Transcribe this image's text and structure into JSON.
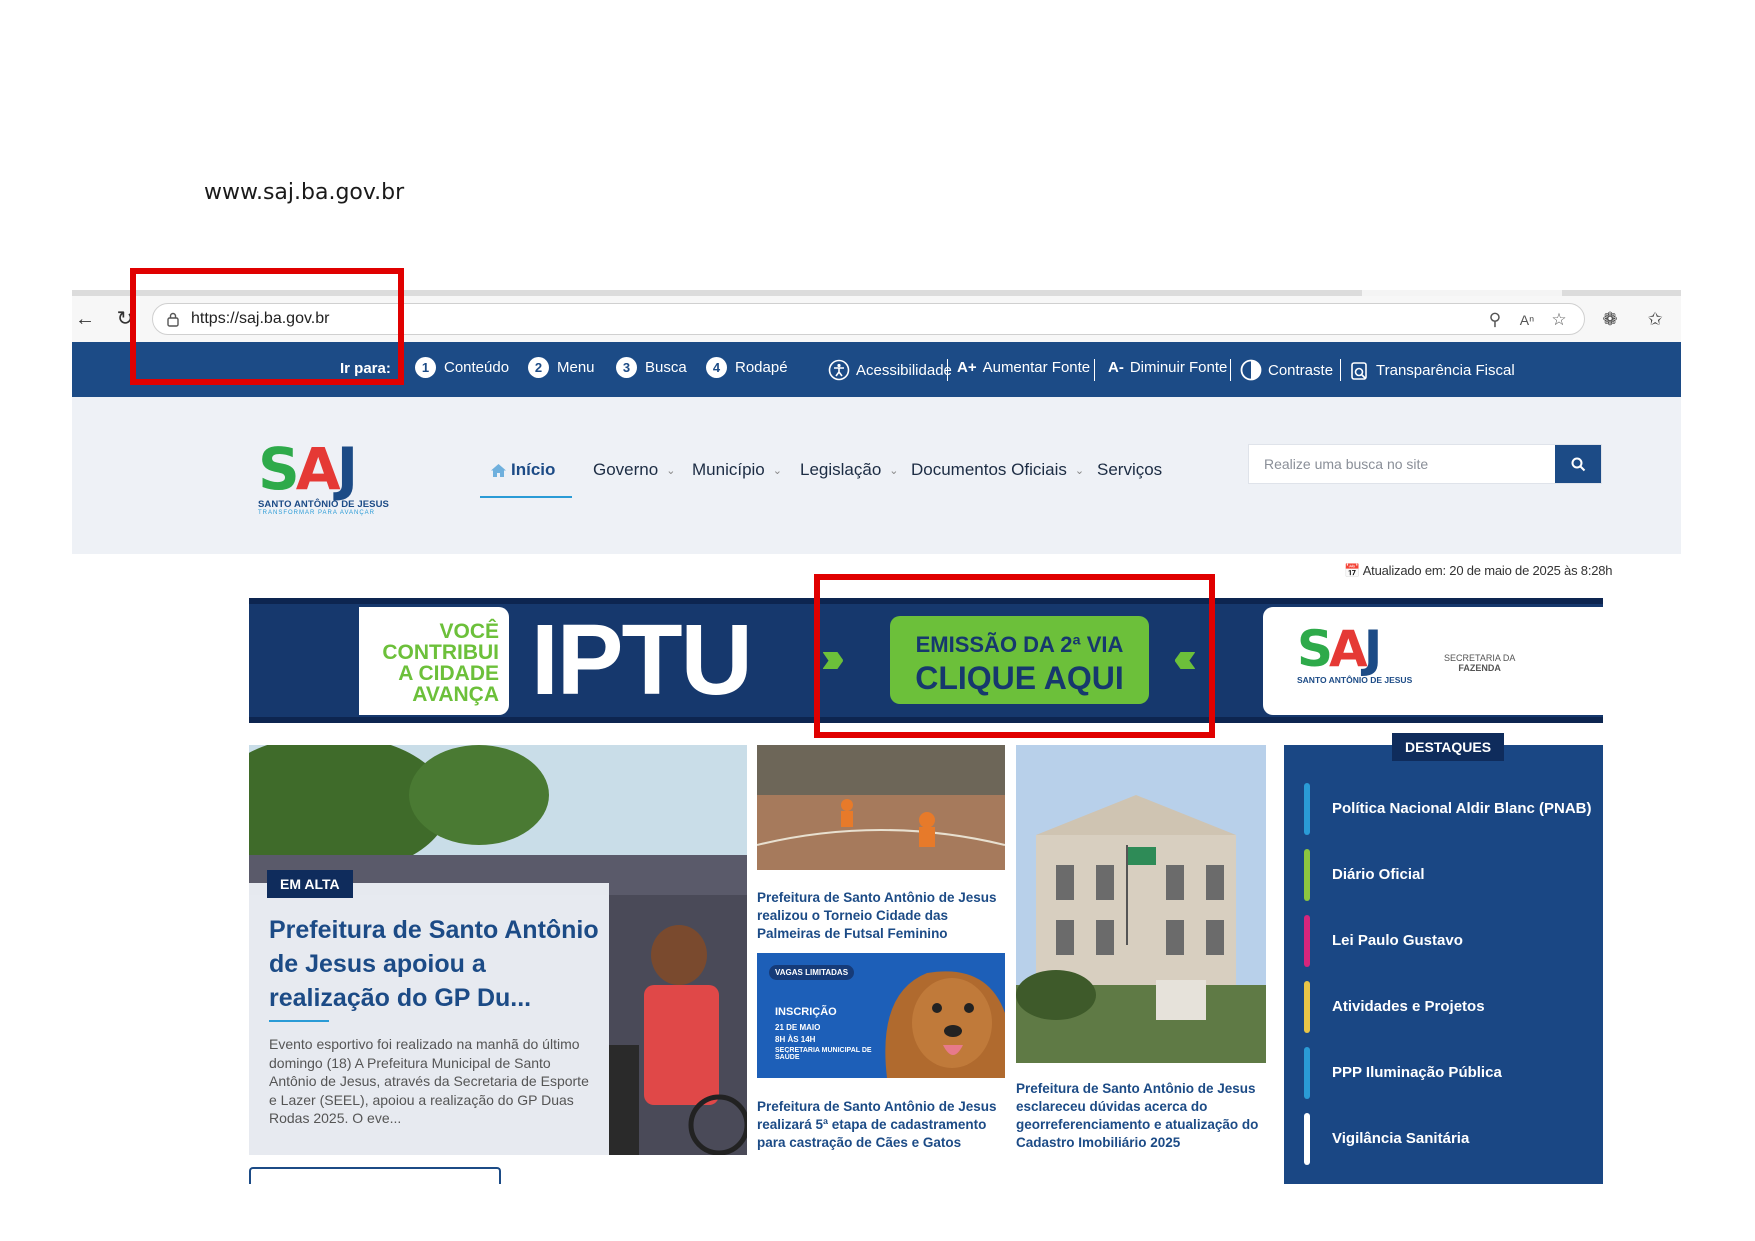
{
  "caption": "www.saj.ba.gov.br",
  "browser": {
    "url": "https://saj.ba.gov.br"
  },
  "a11y_bar": {
    "goto_label": "Ir para:",
    "jumps": [
      {
        "num": "1",
        "label": "Conteúdo"
      },
      {
        "num": "2",
        "label": "Menu"
      },
      {
        "num": "3",
        "label": "Busca"
      },
      {
        "num": "4",
        "label": "Rodapé"
      }
    ],
    "tools": {
      "accessibility": "Acessibilidade",
      "increase_font": "Aumentar Fonte",
      "increase_icon": "A+",
      "decrease_font": "Diminuir Fonte",
      "decrease_icon": "A-",
      "contrast": "Contraste",
      "transparency": "Transparência Fiscal"
    }
  },
  "header": {
    "logo": {
      "letters": [
        "S",
        "A",
        "J"
      ],
      "letter_colors": [
        "#2eaa4a",
        "#e53935",
        "#1c4b86"
      ],
      "subtitle": "SANTO ANTÔNIO DE JESUS",
      "slogan": "TRANSFORMAR PARA AVANÇAR"
    },
    "menu": [
      {
        "label": "Início",
        "active": true,
        "dropdown": false
      },
      {
        "label": "Governo",
        "dropdown": true
      },
      {
        "label": "Município",
        "dropdown": true
      },
      {
        "label": "Legislação",
        "dropdown": true
      },
      {
        "label": "Documentos Oficiais",
        "dropdown": true
      },
      {
        "label": "Serviços",
        "dropdown": false
      }
    ],
    "search_placeholder": "Realize uma busca no site"
  },
  "updated_text": "Atualizado em: 20 de maio de 2025 às 8:28h",
  "banner": {
    "slogan": [
      "VOCÊ",
      "CONTRIBUI",
      "A CIDADE",
      "AVANÇA"
    ],
    "title": "IPTU",
    "cta_line1": "EMISSÃO DA 2ª VIA",
    "cta_line2": "CLIQUE AQUI",
    "secretaria": "SECRETARIA DA",
    "fazenda": "FAZENDA"
  },
  "feature": {
    "tag": "EM ALTA",
    "title": "Prefeitura de Santo Antônio de Jesus apoiou a realização do GP Du...",
    "excerpt": "Evento esportivo foi realizado na manhã do último domingo (18) A Prefeitura Municipal de Santo Antônio de Jesus, através da Secretaria de Esporte e Lazer (SEEL), apoiou a realização do GP Duas Rodas 2025. O eve..."
  },
  "cards": [
    {
      "title": "Prefeitura de Santo Antônio de Jesus realizou o Torneio Cidade das Palmeiras de Futsal Feminino"
    },
    {
      "title": "Prefeitura de Santo Antônio de Jesus realizará 5ª etapa de cadastramento para castração de Cães e Gatos",
      "poster": {
        "badge": "VAGAS LIMITADAS",
        "heading": "INSCRIÇÃO",
        "date": "21 DE MAIO",
        "hours": "8H ÀS 14H",
        "place": "SECRETARIA MUNICIPAL DE SAÚDE"
      }
    },
    {
      "title": "Prefeitura de Santo Antônio de Jesus esclareceu dúvidas acerca do georreferenciamento e atualização do Cadastro Imobiliário 2025"
    }
  ],
  "destaques": {
    "title": "DESTAQUES",
    "items": [
      {
        "label": "Política Nacional Aldir Blanc (PNAB)",
        "color": "#2a9bd6"
      },
      {
        "label": "Diário Oficial",
        "color": "#8cc63f"
      },
      {
        "label": "Lei Paulo Gustavo",
        "color": "#d6257c"
      },
      {
        "label": "Atividades e Projetos",
        "color": "#e8c547"
      },
      {
        "label": "PPP Iluminação Pública",
        "color": "#2a9bd6"
      },
      {
        "label": "Vigilância Sanitária",
        "color": "#ffffff"
      }
    ]
  }
}
